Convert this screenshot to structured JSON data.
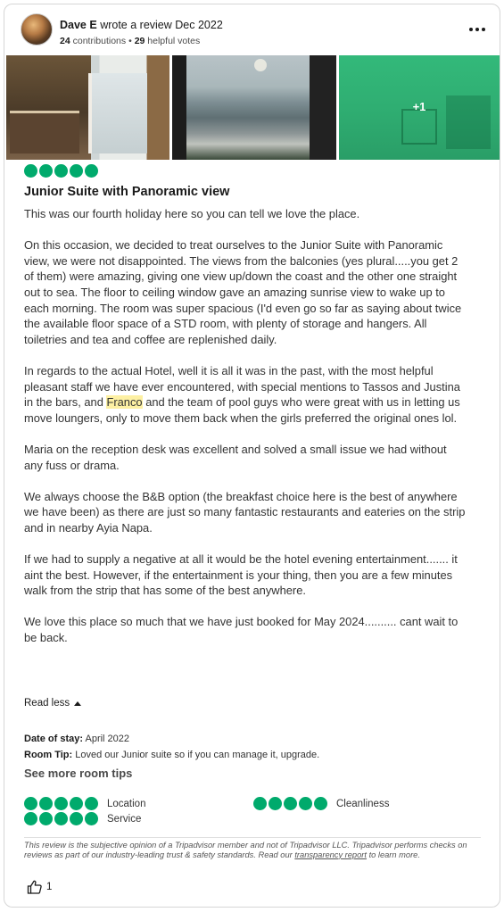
{
  "reviewer": {
    "name": "Dave E",
    "action": "wrote a review",
    "date": "Dec 2022",
    "contributions": "24",
    "contributions_label": "contributions",
    "separator": "•",
    "helpful_votes": "29",
    "helpful_votes_label": "helpful votes"
  },
  "photos": {
    "more_count": "+1"
  },
  "review": {
    "rating": 5,
    "title": "Junior Suite with Panoramic view",
    "paragraphs": [
      "This was our fourth holiday here so you can tell we love the place.",
      "On this occasion, we decided to treat ourselves to the Junior Suite with Panoramic view, we were not disappointed. The views from the balconies (yes plural.....you get 2 of them) were amazing, giving one view up/down the coast and the other one straight out to sea. The floor to ceiling window gave an amazing sunrise view to wake up to each morning. The room was super spacious (I'd even go so far as saying about twice the available floor space of a STD room, with plenty of storage and hangers. All toiletries and tea and coffee are replenished daily.",
      "In regards to the actual Hotel, well it is all it was in the past, with the most helpful pleasant staff we have ever encountered, with special mentions to Tassos and Justina in the bars, and",
      "Maria on the reception desk was excellent and solved a small issue we had without any fuss or drama.",
      "We always choose the B&B option (the breakfast choice here is the best of anywhere we have been) as there are just so many fantastic restaurants and eateries on the strip and in nearby Ayia Napa.",
      "If we had to supply a negative at all it would be the hotel evening entertainment....... it aint the best. However, if the entertainment is your thing, then you are a few minutes walk from the strip that has some of the best anywhere.",
      "We love this place so much that we have just booked for May 2024.......... cant wait to be back."
    ],
    "highlight_name": "Franco",
    "paragraph3_tail": "and the team of pool guys who were great with us in letting us move loungers, only to move them back when the girls preferred the original ones lol.",
    "read_less": "Read less"
  },
  "details": {
    "stay_label": "Date of stay:",
    "stay_value": "April 2022",
    "tip_label": "Room Tip:",
    "tip_value": "Loved our Junior suite so if you can manage it, upgrade.",
    "see_more_tips": "See more room tips"
  },
  "sub_ratings": [
    {
      "label": "Location",
      "rating": 5
    },
    {
      "label": "Cleanliness",
      "rating": 5
    },
    {
      "label": "Service",
      "rating": 5
    }
  ],
  "disclaimer": {
    "text": "This review is the subjective opinion of a Tripadvisor member and not of Tripadvisor LLC. Tripadvisor performs checks on reviews as part of our industry-leading trust & safety standards. Read our",
    "link": "transparency report",
    "tail": "to learn more."
  },
  "helpful": {
    "count": "1"
  },
  "colors": {
    "bubble": "#00aa6c",
    "highlight": "#fdf0a3"
  },
  "icons": {
    "more": "more-dots-icon",
    "thumbs_up": "thumbs-up-icon",
    "caret": "caret-up-icon"
  }
}
